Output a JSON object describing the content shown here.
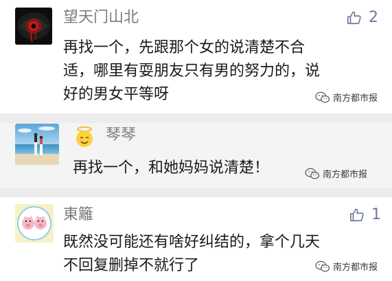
{
  "comments": [
    {
      "username": "望天门山北",
      "lines": [
        "再找一个，先跟那个女的说清楚不合",
        "适，哪里有耍朋友只有男的努力的，说",
        "好的男女平等呀"
      ],
      "likes": "2"
    },
    {
      "username": "琴琴",
      "lines": [
        "再找一个，和她妈妈说清楚！"
      ],
      "likes": ""
    },
    {
      "username": "東籬",
      "lines": [
        "既然没可能还有啥好纠结的，拿个几天",
        "不回复删掉不就行了"
      ],
      "likes": "1"
    }
  ],
  "watermark": {
    "text": "南方都市报"
  },
  "colors": {
    "like_blue": "#6b7a99",
    "username_gray": "#7b7b7b",
    "text_dark": "#1a1a1a",
    "separator": "#ececec"
  },
  "icons": [
    "thumbs-up-icon",
    "wechat-logo-icon",
    "angel-emoji-icon"
  ]
}
